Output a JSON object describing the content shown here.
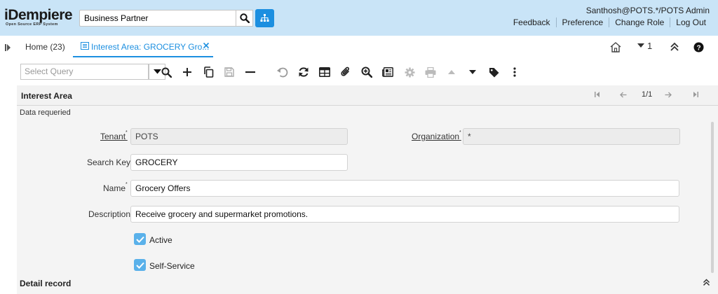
{
  "header": {
    "logo_text": "iDempiere",
    "logo_tagline": "Open Source ERP System",
    "search_value": "Business Partner",
    "user": "Santhosh@POTS.*/POTS Admin",
    "links": [
      "Feedback",
      "Preference",
      "Change Role",
      "Log Out"
    ]
  },
  "tabs": {
    "home": "Home (23)",
    "active": "Interest Area: GROCERY Gro...",
    "count": "1"
  },
  "toolbar": {
    "query_placeholder": "Select Query"
  },
  "grid": {
    "title": "Interest Area",
    "record_nav": "1/1"
  },
  "form": {
    "notice": "Data requeried",
    "tenant_label": "Tenant",
    "tenant_value": "POTS",
    "org_label": "Organization",
    "org_value": "*",
    "searchkey_label": "Search Key",
    "searchkey_value": "GROCERY",
    "name_label": "Name",
    "name_value": "Grocery Offers",
    "description_label": "Description",
    "description_value": "Receive grocery and supermarket promotions.",
    "active_label": "Active",
    "selfservice_label": "Self-Service",
    "required_marker": "*"
  },
  "detail": {
    "title": "Detail record"
  },
  "colors": {
    "header_bg": "#c9e4f7",
    "accent": "#1c8fe0",
    "checkbox": "#5ab1ea"
  }
}
